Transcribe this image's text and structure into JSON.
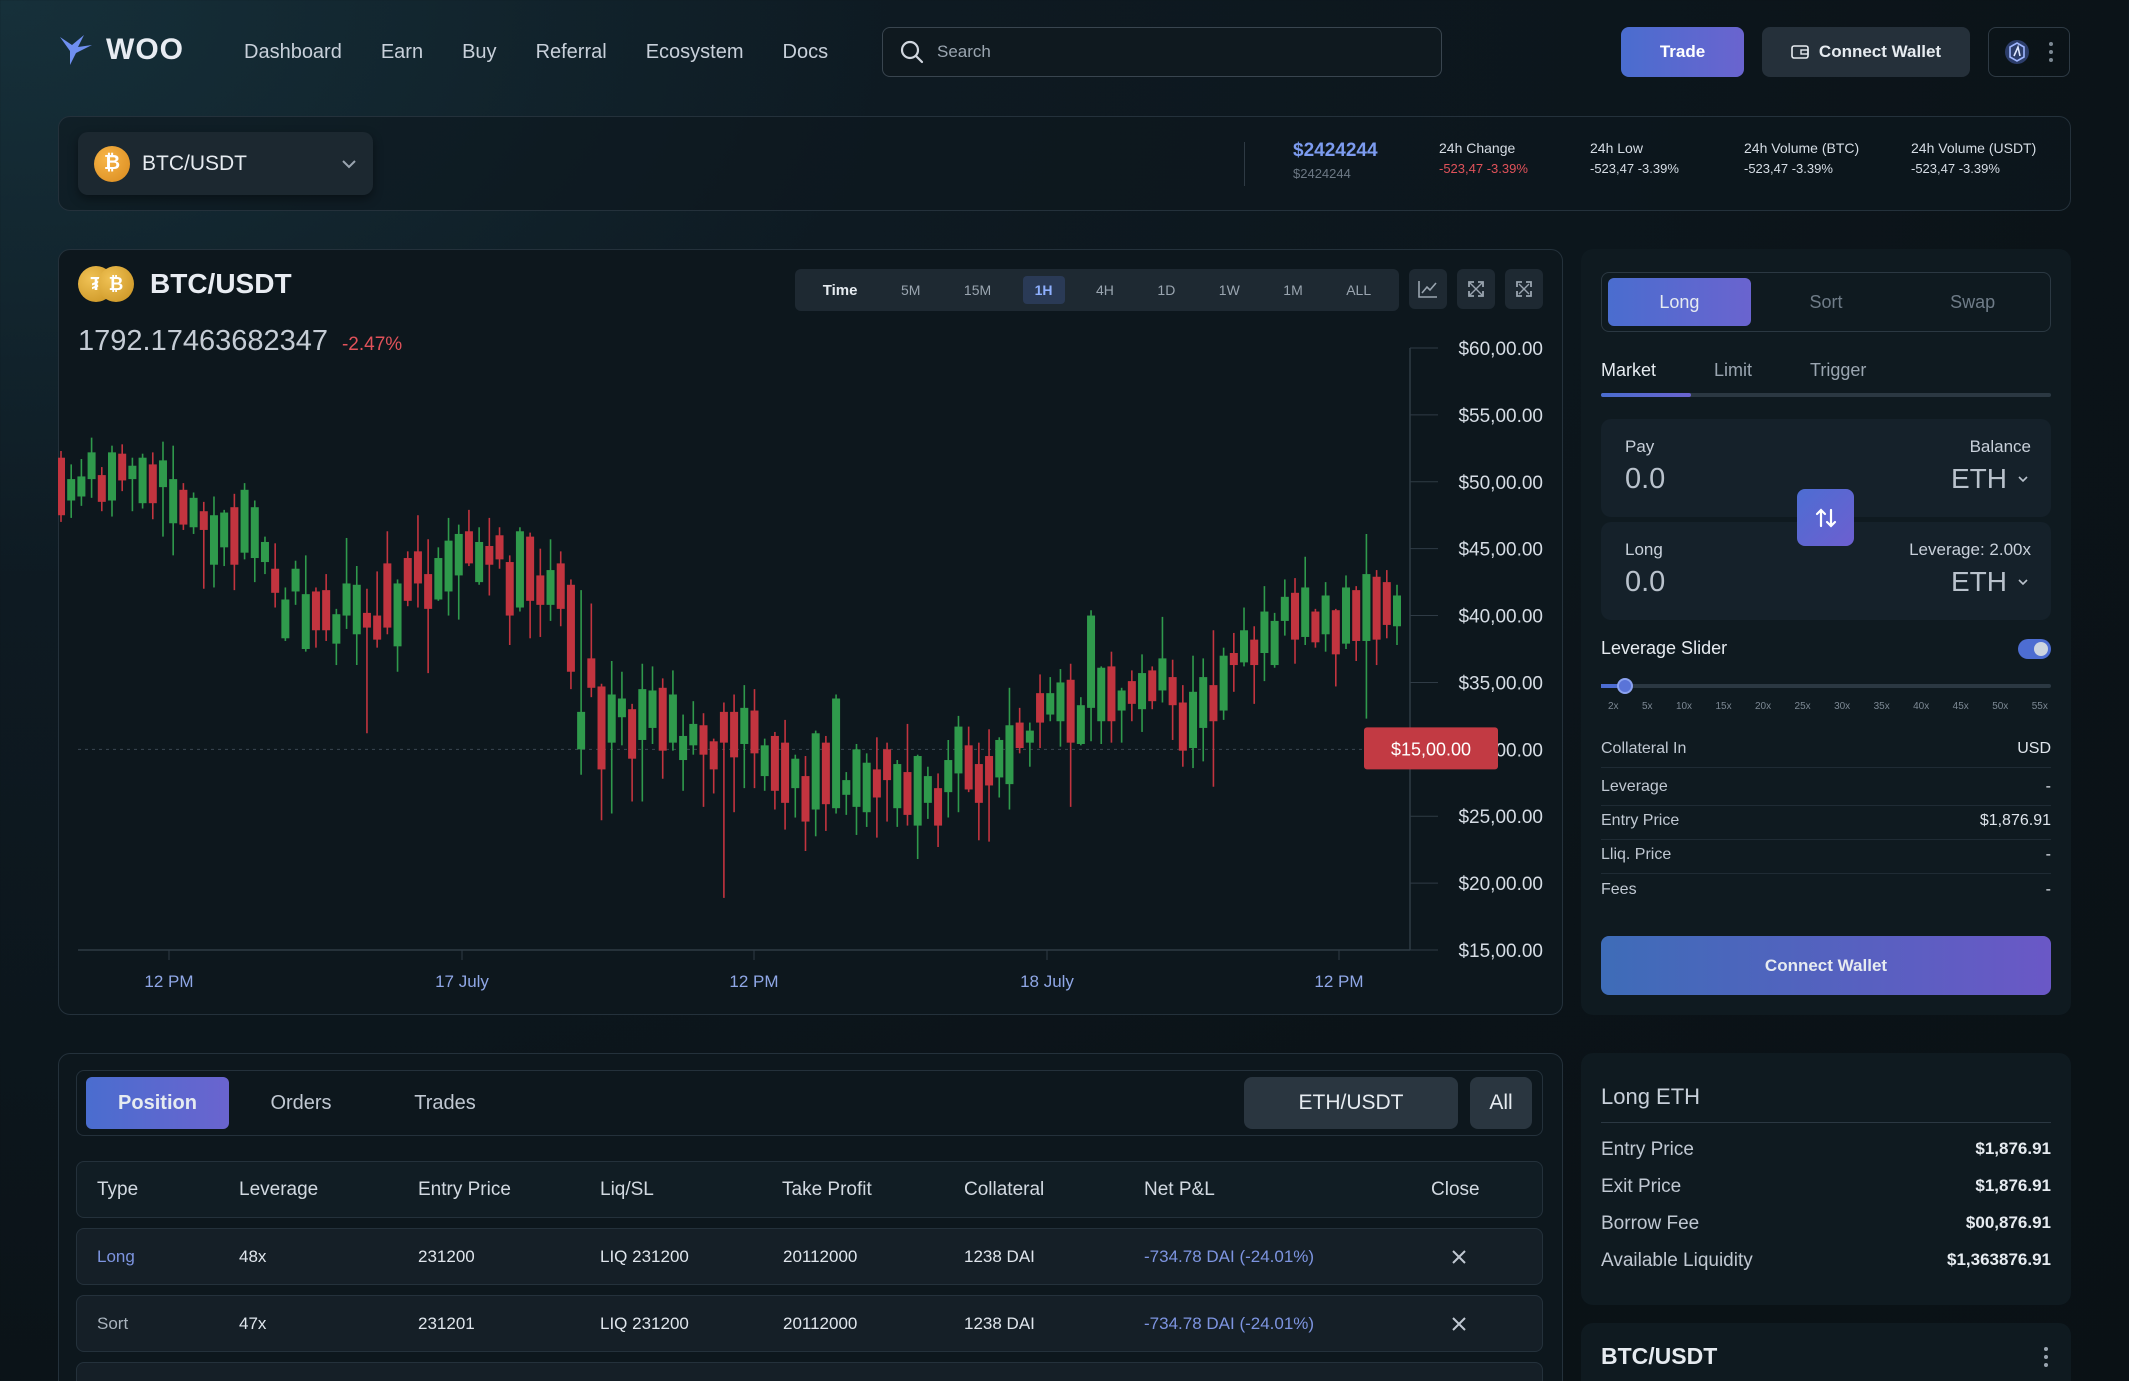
{
  "app": {
    "name": "WOO"
  },
  "nav": {
    "items": [
      "Dashboard",
      "Earn",
      "Buy",
      "Referral",
      "Ecosystem",
      "Docs"
    ]
  },
  "search": {
    "placeholder": "Search"
  },
  "header": {
    "trade_label": "Trade",
    "connect_wallet_label": "Connect Wallet"
  },
  "ticker": {
    "pair": "BTC/USDT",
    "price": "$2424244",
    "price_sub": "$2424244",
    "stats": [
      {
        "label": "24h Change",
        "value": "-523,47 -3.39%",
        "negative": true
      },
      {
        "label": "24h Low",
        "value": "-523,47 -3.39%",
        "negative": false
      },
      {
        "label": "24h Volume (BTC)",
        "value": "-523,47 -3.39%",
        "negative": false
      },
      {
        "label": "24h Volume (USDT)",
        "value": "-523,47 -3.39%",
        "negative": false
      }
    ]
  },
  "chart": {
    "pair": "BTC/USDT",
    "last_price": "1792.17463682347",
    "change": "-2.47%",
    "timeframes": [
      "Time",
      "5M",
      "15M",
      "1H",
      "4H",
      "1D",
      "1W",
      "1M",
      "ALL"
    ],
    "active_timeframe": "1H",
    "price_tag": "$15,00.00"
  },
  "chart_data": {
    "type": "candlestick",
    "y_ticks": [
      "$60,00.00",
      "$55,00.00",
      "$50,00.00",
      "$45,00.00",
      "$40,00.00",
      "$35,00.00",
      "$30,00.00",
      "$25,00.00",
      "$20,00.00",
      "$15,00.00"
    ],
    "x_ticks": [
      "12 PM",
      "17 July",
      "12 PM",
      "18 July",
      "12 PM"
    ],
    "ylim": [
      15,
      60
    ],
    "grid": false,
    "up_color": "#2f9a4c",
    "down_color": "#c2343f",
    "candles": [
      [
        51.8,
        47.5,
        47,
        52.3
      ],
      [
        48.6,
        50.2,
        47.3,
        51.3
      ],
      [
        48.9,
        50.4,
        48.2,
        51.7
      ],
      [
        50.2,
        52.2,
        48.8,
        53.3
      ],
      [
        50.5,
        48.5,
        47.8,
        51.1
      ],
      [
        48.6,
        52.2,
        47.4,
        52.7
      ],
      [
        52.1,
        50.1,
        49.3,
        52.8
      ],
      [
        50.2,
        51.2,
        47.8,
        51.8
      ],
      [
        48.4,
        51.8,
        48,
        52.1
      ],
      [
        51.3,
        48.4,
        47.2,
        52.2
      ],
      [
        49.6,
        51.6,
        45.9,
        53
      ],
      [
        46.9,
        50.2,
        44.5,
        52.7
      ],
      [
        49.4,
        46.8,
        46.4,
        49.9
      ],
      [
        46.6,
        48.8,
        46.1,
        49.2
      ],
      [
        47.8,
        46.4,
        42,
        48.5
      ],
      [
        43.8,
        47.5,
        42.1,
        48.9
      ],
      [
        45.1,
        47.7,
        43.7,
        47.9
      ],
      [
        48.1,
        43.8,
        41.9,
        49.1
      ],
      [
        44.7,
        49.4,
        44.2,
        49.9
      ],
      [
        44.3,
        48.1,
        42.5,
        48.6
      ],
      [
        44,
        45.5,
        43.1,
        45.9
      ],
      [
        43.5,
        41.7,
        40.6,
        45.4
      ],
      [
        38.3,
        41.2,
        38.1,
        42.1
      ],
      [
        41.8,
        43.5,
        40.8,
        44.1
      ],
      [
        37.5,
        41.6,
        37.3,
        44.5
      ],
      [
        41.8,
        38.9,
        37.6,
        42.1
      ],
      [
        41.9,
        38.9,
        38.1,
        43.1
      ],
      [
        37.9,
        40.1,
        36.3,
        40.5
      ],
      [
        40,
        42.4,
        39,
        45.8
      ],
      [
        38.6,
        42.3,
        36.3,
        43.7
      ],
      [
        40.2,
        39.1,
        31.2,
        42
      ],
      [
        40,
        38.2,
        37.6,
        43.3
      ],
      [
        43.9,
        39.1,
        38.6,
        46.3
      ],
      [
        37.7,
        42.4,
        35.8,
        42.7
      ],
      [
        44.3,
        41.1,
        40.7,
        44.8
      ],
      [
        44.8,
        42.4,
        40.6,
        47.5
      ],
      [
        43.1,
        40.5,
        35.7,
        45.7
      ],
      [
        41.2,
        44.3,
        41.1,
        45.1
      ],
      [
        41.8,
        45.6,
        40,
        47.3
      ],
      [
        43,
        46.1,
        39.7,
        46.8
      ],
      [
        46.3,
        43.9,
        43.7,
        47.9
      ],
      [
        42.5,
        45.5,
        42.3,
        46.6
      ],
      [
        45.2,
        43.8,
        41.5,
        47.3
      ],
      [
        46,
        44.2,
        43.5,
        46.6
      ],
      [
        44,
        40,
        37.8,
        44.5
      ],
      [
        40.6,
        46.3,
        40.3,
        46.6
      ],
      [
        45.9,
        41.1,
        38.3,
        46.2
      ],
      [
        43,
        40.8,
        38.4,
        45
      ],
      [
        40.8,
        43.4,
        39.6,
        45.7
      ],
      [
        43.9,
        40.5,
        39.2,
        44.8
      ],
      [
        42.3,
        35.8,
        34.5,
        42.7
      ],
      [
        30,
        32.8,
        28.1,
        41.9
      ],
      [
        36.8,
        34.6,
        33.9,
        40.9
      ],
      [
        34.7,
        28.5,
        24.7,
        34.9
      ],
      [
        30.5,
        34.1,
        25.2,
        36.6
      ],
      [
        32.4,
        33.8,
        30.3,
        35.8
      ],
      [
        33,
        29.3,
        26.1,
        33.4
      ],
      [
        30.7,
        34.5,
        26.1,
        36.4
      ],
      [
        31.6,
        34.4,
        30.4,
        36.2
      ],
      [
        34.6,
        29.9,
        27.8,
        35.3
      ],
      [
        30.5,
        34.1,
        29.9,
        35.9
      ],
      [
        29.2,
        31,
        26.9,
        32.6
      ],
      [
        30.3,
        31.9,
        29.6,
        33.6
      ],
      [
        31.8,
        29.6,
        25.7,
        32.7
      ],
      [
        30.6,
        28.5,
        26.7,
        30.8
      ],
      [
        32.8,
        30.5,
        18.9,
        33.5
      ],
      [
        32.8,
        29.4,
        25.3,
        34.1
      ],
      [
        30.4,
        33.1,
        27.1,
        34.8
      ],
      [
        32.9,
        29.7,
        27.1,
        34.5
      ],
      [
        28,
        30.3,
        26.9,
        30.8
      ],
      [
        31,
        26.9,
        25.5,
        31.3
      ],
      [
        30.5,
        26,
        24,
        32.2
      ],
      [
        27.1,
        29.3,
        24.9,
        29.6
      ],
      [
        28,
        24.6,
        22.4,
        29.5
      ],
      [
        25.5,
        31.2,
        23.5,
        31.4
      ],
      [
        30.5,
        25.9,
        23.9,
        31
      ],
      [
        25.6,
        33.8,
        25.2,
        34.1
      ],
      [
        26.6,
        27.7,
        25.1,
        28.3
      ],
      [
        25.7,
        30,
        23.6,
        30.4
      ],
      [
        25.3,
        29,
        24.2,
        29.7
      ],
      [
        28.5,
        26.4,
        23.4,
        30.9
      ],
      [
        30,
        27.7,
        24.6,
        30.5
      ],
      [
        25.6,
        28.9,
        24.2,
        29.2
      ],
      [
        28.3,
        25.1,
        24.3,
        31.9
      ],
      [
        24.3,
        29.5,
        21.8,
        29.6
      ],
      [
        26,
        28,
        24.8,
        28.7
      ],
      [
        27.1,
        24.3,
        22.7,
        28.2
      ],
      [
        26.8,
        29.2,
        24.9,
        30.7
      ],
      [
        28.2,
        31.7,
        25.3,
        32.5
      ],
      [
        30.3,
        27,
        26.8,
        31.7
      ],
      [
        28.9,
        26,
        23.2,
        30.5
      ],
      [
        29.5,
        27.3,
        23.1,
        31.5
      ],
      [
        27.9,
        30.7,
        26.4,
        30.9
      ],
      [
        27.4,
        31.8,
        25.5,
        34.6
      ],
      [
        32,
        30.1,
        29.7,
        33.1
      ],
      [
        30.5,
        31.4,
        28.7,
        32
      ],
      [
        34.2,
        32,
        30.1,
        35.6
      ],
      [
        32.6,
        34.2,
        32.1,
        35.4
      ],
      [
        32.1,
        35,
        30.2,
        36
      ],
      [
        35.2,
        30.5,
        25.7,
        36.4
      ],
      [
        30.4,
        33.3,
        30.3,
        33.9
      ],
      [
        33.1,
        40,
        30.6,
        40.4
      ],
      [
        32.1,
        36.1,
        30.4,
        36.2
      ],
      [
        36.2,
        32.1,
        30.5,
        37.3
      ],
      [
        32.9,
        34.4,
        30.5,
        34.6
      ],
      [
        35.1,
        33.4,
        32.1,
        35.9
      ],
      [
        33,
        35.7,
        31.3,
        37.1
      ],
      [
        35.9,
        33.6,
        33,
        36.2
      ],
      [
        34.4,
        36.8,
        33.5,
        39.9
      ],
      [
        35.4,
        33.3,
        30.7,
        36.7
      ],
      [
        33.5,
        29.9,
        28.7,
        34.8
      ],
      [
        30.1,
        34.3,
        28.6,
        37
      ],
      [
        31.6,
        35.4,
        29.1,
        36.8
      ],
      [
        34.8,
        32.1,
        27.2,
        38.9
      ],
      [
        32.9,
        37,
        32.2,
        37.6
      ],
      [
        37.2,
        36.3,
        34.3,
        38.7
      ],
      [
        36.5,
        38.9,
        36.2,
        40.6
      ],
      [
        38.2,
        36.3,
        33.4,
        39.2
      ],
      [
        37.2,
        40.3,
        35.1,
        42.2
      ],
      [
        36.3,
        39.6,
        36.1,
        40.2
      ],
      [
        39.6,
        41.4,
        38.5,
        42.7
      ],
      [
        41.7,
        38.2,
        36.4,
        42.8
      ],
      [
        38.4,
        42.1,
        37.8,
        44.4
      ],
      [
        40.3,
        38,
        37.6,
        40.5
      ],
      [
        38.6,
        41.5,
        37.3,
        42.5
      ],
      [
        40.4,
        37.1,
        34.7,
        40.5
      ],
      [
        37.9,
        42.1,
        37.5,
        43
      ],
      [
        41.9,
        38.1,
        36.6,
        42.2
      ],
      [
        38.1,
        43.1,
        32.3,
        46.1
      ],
      [
        42.9,
        38.2,
        36.3,
        43.4
      ],
      [
        42.5,
        39.3,
        38.3,
        43.4
      ],
      [
        39.2,
        41.5,
        37.8,
        42.3
      ]
    ]
  },
  "order": {
    "sides": [
      "Long",
      "Sort",
      "Swap"
    ],
    "active_side": "Long",
    "types": [
      "Market",
      "Limit",
      "Trigger"
    ],
    "active_type": "Market",
    "pay": {
      "label": "Pay",
      "value": "0.0",
      "right_label": "Balance",
      "token": "ETH"
    },
    "long": {
      "label": "Long",
      "value": "0.0",
      "right_label": "Leverage: 2.00x",
      "token": "ETH"
    },
    "leverage_slider": {
      "label": "Leverage Slider",
      "enabled": true,
      "value_x": 2,
      "ticks": [
        "2x",
        "5x",
        "10x",
        "15x",
        "20x",
        "25x",
        "30x",
        "35x",
        "40x",
        "45x",
        "50x",
        "55x"
      ]
    },
    "info": [
      {
        "k": "Collateral In",
        "v": "USD"
      },
      {
        "k": "Leverage",
        "v": "-"
      },
      {
        "k": "Entry Price",
        "v": "$1,876.91"
      },
      {
        "k": "Lliq. Price",
        "v": "-"
      },
      {
        "k": "Fees",
        "v": "-"
      }
    ],
    "connect_label": "Connect Wallet"
  },
  "positions": {
    "tabs": [
      "Position",
      "Orders",
      "Trades"
    ],
    "active_tab": "Position",
    "pair_filter": "ETH/USDT",
    "all_label": "All",
    "columns": [
      "Type",
      "Leverage",
      "Entry Price",
      "Liq/SL",
      "Take Profit",
      "Collateral",
      "Net P&L",
      "Close"
    ],
    "rows": [
      {
        "type": "Long",
        "leverage": "48x",
        "entry": "231200",
        "liq": "LIQ 231200",
        "tp": "20112000",
        "collateral": "1238 DAI",
        "pnl": "-734.78 DAI (-24.01%)"
      },
      {
        "type": "Sort",
        "leverage": "47x",
        "entry": "231201",
        "liq": "LIQ 231200",
        "tp": "20112000",
        "collateral": "1238 DAI",
        "pnl": "-734.78 DAI (-24.01%)"
      }
    ]
  },
  "long_eth": {
    "title": "Long ETH",
    "rows": [
      {
        "k": "Entry Price",
        "v": "$1,876.91"
      },
      {
        "k": "Exit Price",
        "v": "$1,876.91"
      },
      {
        "k": "Borrow Fee",
        "v": "$00,876.91"
      },
      {
        "k": "Available Liquidity",
        "v": "$1,363876.91"
      }
    ]
  },
  "market_panel": {
    "title": "BTC/USDT"
  }
}
